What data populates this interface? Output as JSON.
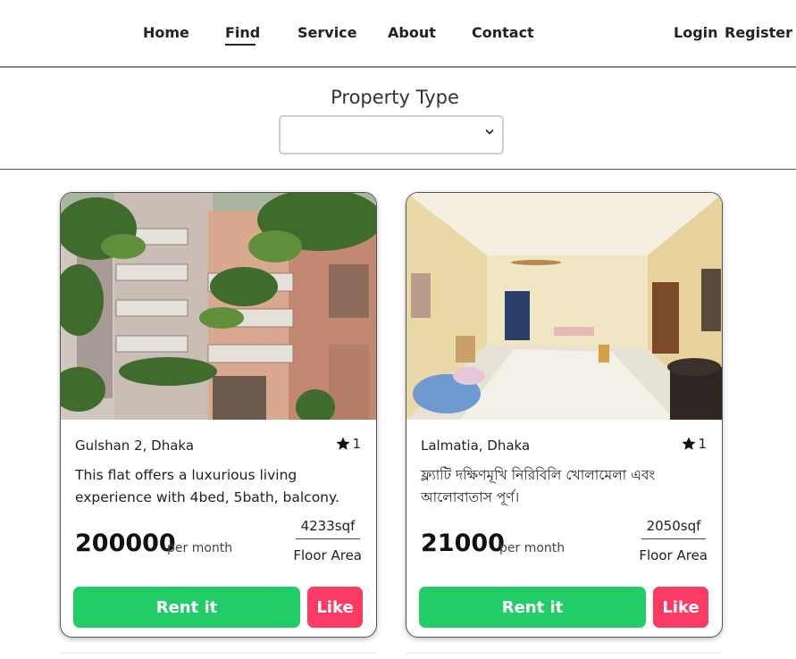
{
  "nav": {
    "items": [
      {
        "label": "Home"
      },
      {
        "label": "Find"
      },
      {
        "label": "Service"
      },
      {
        "label": "About"
      },
      {
        "label": "Contact"
      }
    ],
    "login": "Login",
    "register": "Register",
    "active": "Find"
  },
  "filter": {
    "label": "Property Type",
    "selected": ""
  },
  "colors": {
    "rent_button": "#22cc66",
    "like_button": "#fb3b62"
  },
  "cards": [
    {
      "location": "Gulshan 2, Dhaka",
      "likes": "1",
      "description": "This flat offers a luxurious living experience with 4bed, 5bath, balcony.",
      "price": "200000",
      "price_unit": "per month",
      "area": "4233sqf",
      "area_label": "Floor Area",
      "rent_label": "Rent it",
      "like_label": "Like",
      "photo": "apartment-building-exterior"
    },
    {
      "location": "Lalmatia, Dhaka",
      "likes": "1",
      "description": "ফ্ল্যাটি দক্ষিণমূখি নিরিবিলি খোলামেলা এবং আলোবাতাস পূর্ণ।",
      "price": "21000",
      "price_unit": "per month",
      "area": "2050sqf",
      "area_label": "Floor Area",
      "rent_label": "Rent it",
      "like_label": "Like",
      "photo": "apartment-interior-living-room"
    }
  ]
}
